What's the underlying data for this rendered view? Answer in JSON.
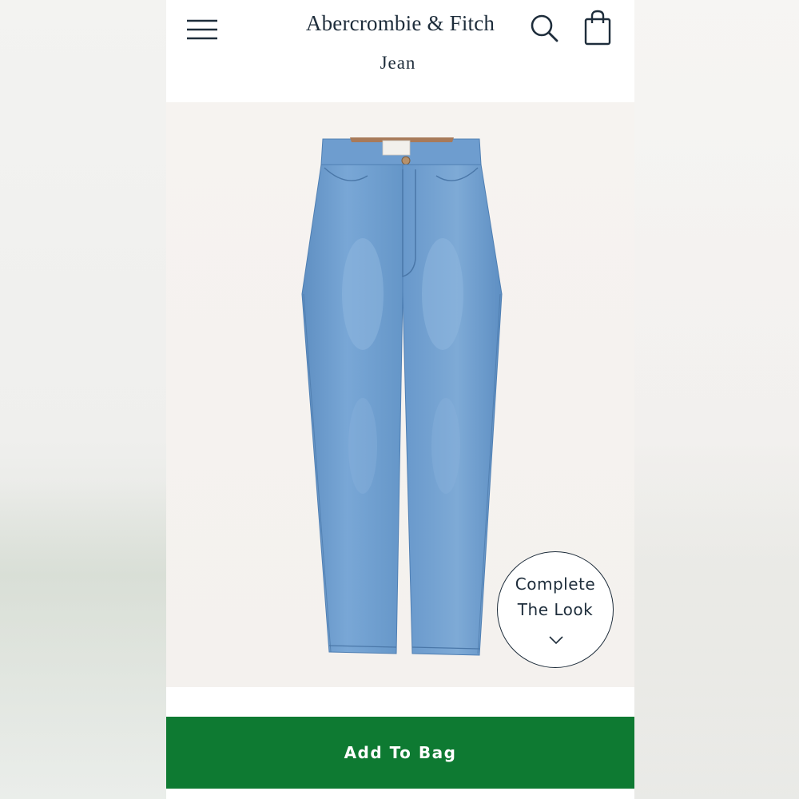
{
  "header": {
    "brand": "Abercrombie & Fitch",
    "page_title": "Jean",
    "icons": {
      "menu": "hamburger-menu-icon",
      "search": "search-icon",
      "bag": "shopping-bag-icon"
    }
  },
  "product": {
    "image": "light-wash-straight-jeans",
    "complete_look": {
      "line1": "Complete",
      "line2": "The Look",
      "icon": "chevron-down-icon"
    }
  },
  "actions": {
    "add_to_bag_label": "Add To Bag"
  },
  "colors": {
    "text_navy": "#1e2d3b",
    "cta_green": "#0e7a32",
    "denim": "#6f9fcf"
  }
}
